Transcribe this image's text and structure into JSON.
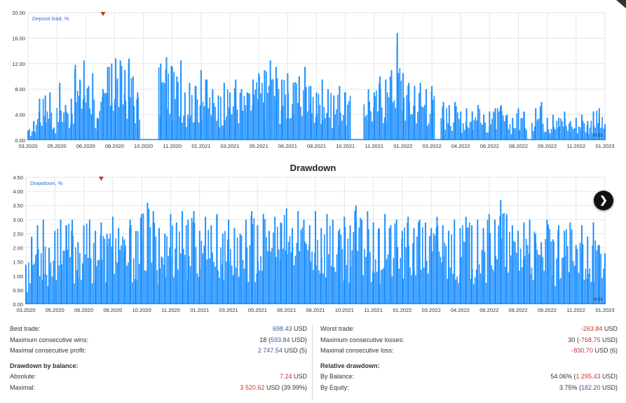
{
  "chart_data": [
    {
      "type": "bar",
      "title": "",
      "legend_label": "Deposit load, %",
      "legend_position": "top-left",
      "grid": true,
      "color": "#1e90ff",
      "y_ticks": [
        "0.00",
        "4.00",
        "8.00",
        "12.00",
        "16.00",
        "20.00"
      ],
      "ylim": [
        0,
        20
      ],
      "x_ticks": [
        "03.2020",
        "05.2020",
        "06.2020",
        "08.2020",
        "10.2020",
        "11.2020",
        "01.2021",
        "03.2021",
        "05.2021",
        "06.2021",
        "08.2021",
        "10.2021",
        "11.2021",
        "01.2022",
        "03.2022",
        "04.2022",
        "06.2022",
        "08.2022",
        "09.2022",
        "11.2022",
        "01.2023"
      ],
      "end_label": "0.01",
      "peaks": [
        [
          0.0,
          1.5
        ],
        [
          0.01,
          3.0
        ],
        [
          0.02,
          6.5
        ],
        [
          0.03,
          7.0
        ],
        [
          0.038,
          7.5
        ],
        [
          0.045,
          2.0
        ],
        [
          0.055,
          9.0
        ],
        [
          0.065,
          5.5
        ],
        [
          0.075,
          6.5
        ],
        [
          0.082,
          11.8
        ],
        [
          0.09,
          9.5
        ],
        [
          0.097,
          12.5
        ],
        [
          0.105,
          8.5
        ],
        [
          0.112,
          10.5
        ],
        [
          0.12,
          3.5
        ],
        [
          0.13,
          8.0
        ],
        [
          0.138,
          11.5
        ],
        [
          0.145,
          12.0
        ],
        [
          0.152,
          12.8
        ],
        [
          0.16,
          12.5
        ],
        [
          0.168,
          11.0
        ],
        [
          0.175,
          12.8
        ],
        [
          0.182,
          10.0
        ],
        [
          0.19,
          7.5
        ],
        [
          0.23,
          12.0
        ],
        [
          0.24,
          13.0
        ],
        [
          0.25,
          11.5
        ],
        [
          0.258,
          10.0
        ],
        [
          0.265,
          12.5
        ],
        [
          0.272,
          7.5
        ],
        [
          0.28,
          9.0
        ],
        [
          0.29,
          8.5
        ],
        [
          0.3,
          11.0
        ],
        [
          0.31,
          9.5
        ],
        [
          0.32,
          8.0
        ],
        [
          0.33,
          7.0
        ],
        [
          0.34,
          9.0
        ],
        [
          0.35,
          7.5
        ],
        [
          0.36,
          9.5
        ],
        [
          0.37,
          8.0
        ],
        [
          0.38,
          7.5
        ],
        [
          0.39,
          9.5
        ],
        [
          0.4,
          10.5
        ],
        [
          0.41,
          11.0
        ],
        [
          0.42,
          12.5
        ],
        [
          0.43,
          11.5
        ],
        [
          0.44,
          9.5
        ],
        [
          0.45,
          10.5
        ],
        [
          0.46,
          9.0
        ],
        [
          0.47,
          10.0
        ],
        [
          0.48,
          11.5
        ],
        [
          0.49,
          8.5
        ],
        [
          0.5,
          7.5
        ],
        [
          0.51,
          9.5
        ],
        [
          0.52,
          8.0
        ],
        [
          0.53,
          7.0
        ],
        [
          0.54,
          8.5
        ],
        [
          0.55,
          7.5
        ],
        [
          0.56,
          7.0
        ],
        [
          0.57,
          8.0
        ],
        [
          0.58,
          9.5
        ],
        [
          0.59,
          8.0
        ],
        [
          0.6,
          7.5
        ],
        [
          0.61,
          10.0
        ],
        [
          0.62,
          9.5
        ],
        [
          0.63,
          11.0
        ],
        [
          0.64,
          16.8
        ],
        [
          0.65,
          10.5
        ],
        [
          0.66,
          9.0
        ],
        [
          0.67,
          8.5
        ],
        [
          0.68,
          9.0
        ],
        [
          0.69,
          8.0
        ],
        [
          0.7,
          8.5
        ],
        [
          0.71,
          6.5
        ],
        [
          0.72,
          6.0
        ],
        [
          0.73,
          5.5
        ],
        [
          0.74,
          6.0
        ],
        [
          0.75,
          4.5
        ],
        [
          0.76,
          5.0
        ],
        [
          0.77,
          4.5
        ],
        [
          0.78,
          5.5
        ],
        [
          0.79,
          4.0
        ],
        [
          0.8,
          4.5
        ],
        [
          0.81,
          5.0
        ],
        [
          0.82,
          5.5
        ],
        [
          0.83,
          4.0
        ],
        [
          0.84,
          3.5
        ],
        [
          0.85,
          5.0
        ],
        [
          0.86,
          4.5
        ],
        [
          0.87,
          6.5
        ],
        [
          0.88,
          5.0
        ],
        [
          0.89,
          6.0
        ],
        [
          0.9,
          3.5
        ],
        [
          0.91,
          4.0
        ],
        [
          0.92,
          3.5
        ],
        [
          0.93,
          4.5
        ],
        [
          0.94,
          3.0
        ],
        [
          0.95,
          3.5
        ],
        [
          0.96,
          4.0
        ],
        [
          0.97,
          3.0
        ],
        [
          0.98,
          4.5
        ],
        [
          0.99,
          5.0
        ],
        [
          1.0,
          2.5
        ]
      ],
      "gaps": [
        [
          0.195,
          0.225
        ],
        [
          0.56,
          0.58
        ],
        [
          0.705,
          0.715
        ],
        [
          0.865,
          0.872
        ]
      ]
    },
    {
      "type": "bar",
      "title": "Drawdown",
      "legend_label": "Drawdown, %",
      "legend_position": "top-left",
      "grid": true,
      "color": "#1e90ff",
      "y_ticks": [
        "0.00",
        "0.50",
        "1.00",
        "1.50",
        "2.00",
        "2.50",
        "3.00",
        "3.50",
        "4.00",
        "4.50"
      ],
      "ylim": [
        0,
        4.5
      ],
      "x_ticks": [
        "03.2020",
        "05.2020",
        "06.2020",
        "08.2020",
        "10.2020",
        "11.2020",
        "01.2021",
        "03.2021",
        "05.2021",
        "06.2021",
        "08.2021",
        "10.2021",
        "11.2021",
        "01.2022",
        "03.2022",
        "04.2022",
        "06.2022",
        "08.2022",
        "09.2022",
        "11.2022",
        "01.2023"
      ],
      "end_label": "0.01",
      "peaks": [
        [
          0.0,
          1.4
        ],
        [
          0.01,
          2.4
        ],
        [
          0.02,
          2.8
        ],
        [
          0.03,
          3.0
        ],
        [
          0.04,
          2.0
        ],
        [
          0.05,
          2.6
        ],
        [
          0.06,
          3.0
        ],
        [
          0.07,
          2.8
        ],
        [
          0.08,
          3.0
        ],
        [
          0.09,
          2.2
        ],
        [
          0.1,
          2.8
        ],
        [
          0.11,
          3.0
        ],
        [
          0.12,
          2.6
        ],
        [
          0.13,
          2.9
        ],
        [
          0.14,
          2.5
        ],
        [
          0.15,
          3.1
        ],
        [
          0.16,
          2.7
        ],
        [
          0.17,
          2.3
        ],
        [
          0.18,
          3.0
        ],
        [
          0.19,
          2.6
        ],
        [
          0.2,
          3.2
        ],
        [
          0.21,
          3.6
        ],
        [
          0.22,
          3.3
        ],
        [
          0.23,
          2.7
        ],
        [
          0.24,
          2.5
        ],
        [
          0.25,
          3.2
        ],
        [
          0.26,
          2.9
        ],
        [
          0.27,
          3.3
        ],
        [
          0.28,
          3.0
        ],
        [
          0.29,
          3.3
        ],
        [
          0.3,
          2.6
        ],
        [
          0.31,
          3.1
        ],
        [
          0.32,
          2.8
        ],
        [
          0.33,
          3.2
        ],
        [
          0.34,
          2.5
        ],
        [
          0.35,
          3.0
        ],
        [
          0.36,
          2.7
        ],
        [
          0.37,
          2.5
        ],
        [
          0.38,
          3.0
        ],
        [
          0.39,
          3.3
        ],
        [
          0.4,
          2.8
        ],
        [
          0.41,
          3.2
        ],
        [
          0.42,
          2.6
        ],
        [
          0.43,
          3.1
        ],
        [
          0.44,
          2.9
        ],
        [
          0.45,
          3.4
        ],
        [
          0.46,
          2.7
        ],
        [
          0.47,
          3.3
        ],
        [
          0.48,
          3.0
        ],
        [
          0.49,
          2.8
        ],
        [
          0.5,
          3.3
        ],
        [
          0.51,
          2.7
        ],
        [
          0.52,
          3.2
        ],
        [
          0.53,
          3.0
        ],
        [
          0.54,
          2.6
        ],
        [
          0.55,
          3.1
        ],
        [
          0.56,
          2.8
        ],
        [
          0.57,
          3.5
        ],
        [
          0.58,
          3.0
        ],
        [
          0.59,
          3.3
        ],
        [
          0.6,
          2.9
        ],
        [
          0.61,
          2.7
        ],
        [
          0.62,
          3.2
        ],
        [
          0.63,
          2.8
        ],
        [
          0.64,
          3.0
        ],
        [
          0.65,
          2.6
        ],
        [
          0.66,
          3.1
        ],
        [
          0.67,
          2.7
        ],
        [
          0.68,
          3.0
        ],
        [
          0.69,
          2.9
        ],
        [
          0.7,
          2.7
        ],
        [
          0.71,
          3.1
        ],
        [
          0.72,
          2.8
        ],
        [
          0.73,
          2.6
        ],
        [
          0.74,
          3.0
        ],
        [
          0.75,
          2.7
        ],
        [
          0.76,
          3.1
        ],
        [
          0.77,
          2.8
        ],
        [
          0.78,
          3.0
        ],
        [
          0.79,
          2.7
        ],
        [
          0.8,
          3.2
        ],
        [
          0.81,
          3.0
        ],
        [
          0.82,
          3.7
        ],
        [
          0.83,
          3.2
        ],
        [
          0.84,
          2.8
        ],
        [
          0.85,
          2.6
        ],
        [
          0.86,
          2.9
        ],
        [
          0.87,
          3.0
        ],
        [
          0.88,
          2.5
        ],
        [
          0.89,
          2.2
        ],
        [
          0.9,
          3.0
        ],
        [
          0.91,
          2.3
        ],
        [
          0.92,
          2.8
        ],
        [
          0.93,
          2.6
        ],
        [
          0.94,
          2.9
        ],
        [
          0.95,
          2.1
        ],
        [
          0.96,
          2.8
        ],
        [
          0.97,
          2.4
        ],
        [
          0.98,
          2.9
        ],
        [
          0.99,
          2.1
        ],
        [
          1.0,
          1.8
        ]
      ],
      "gaps": []
    }
  ],
  "stats": {
    "left": {
      "best_trade": {
        "label": "Best trade:",
        "value": "698.43",
        "unit": "USD"
      },
      "max_consec_wins": {
        "label": "Maximum consecutive wins:",
        "count": "18",
        "amount": "593.84",
        "unit": "USD"
      },
      "max_consec_profit": {
        "label": "Maximal consecutive profit:",
        "amount": "2 747.54",
        "unit": "USD",
        "count": "5"
      },
      "drawdown_heading": "Drawdown by balance:",
      "absolute": {
        "label": "Absolute:",
        "value": "7.24",
        "unit": "USD"
      },
      "maximal": {
        "label": "Maximal:",
        "amount": "3 520.62",
        "unit": "USD",
        "percent": "39.99%"
      }
    },
    "right": {
      "worst_trade": {
        "label": "Worst trade:",
        "value": "-263.84",
        "unit": "USD"
      },
      "max_consec_losses": {
        "label": "Maximum consecutive losses:",
        "count": "30",
        "amount": "-768.75",
        "unit": "USD"
      },
      "max_consec_loss": {
        "label": "Maximal consecutive loss:",
        "amount": "-830.70",
        "unit": "USD",
        "count": "6"
      },
      "relative_heading": "Relative drawdown:",
      "by_balance": {
        "label": "By Balance:",
        "percent": "54.06%",
        "amount": "1 295.43",
        "unit": "USD"
      },
      "by_equity": {
        "label": "By Equity:",
        "percent": "3.75%",
        "amount": "182.20",
        "unit": "USD"
      }
    }
  }
}
